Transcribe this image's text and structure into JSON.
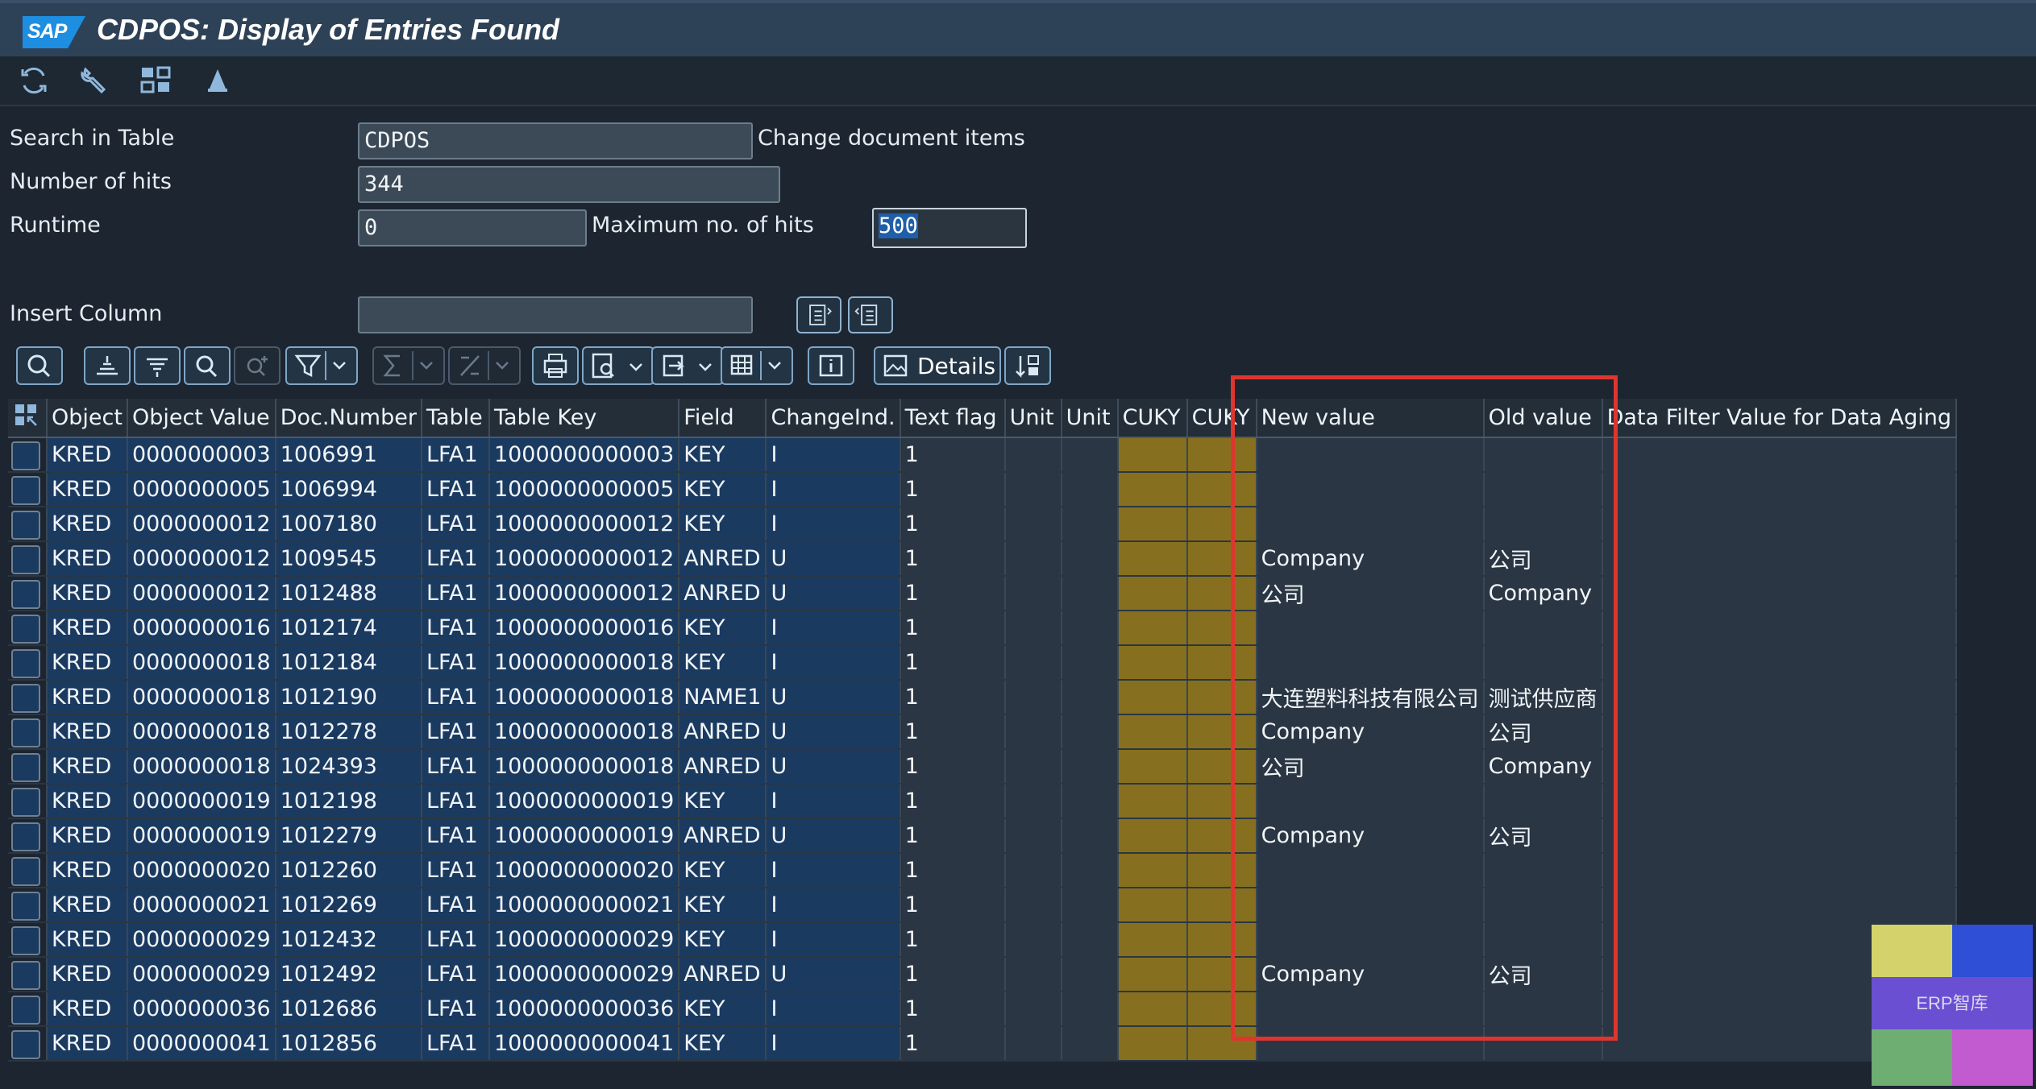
{
  "app": {
    "logo_text": "SAP",
    "title": "CDPOS: Display of Entries Found"
  },
  "toolbar": {
    "icons": [
      "refresh-icon",
      "wrench-icon",
      "structure-icon",
      "drop-icon"
    ]
  },
  "form": {
    "search_in_table_label": "Search in Table",
    "search_in_table_value": "CDPOS",
    "table_description": "Change document items",
    "number_of_hits_label": "Number of hits",
    "number_of_hits_value": "344",
    "runtime_label": "Runtime",
    "runtime_value": "0",
    "max_hits_label": "Maximum no. of hits",
    "max_hits_value": "500",
    "insert_column_label": "Insert Column",
    "insert_column_value": ""
  },
  "alv_toolbar": {
    "details_label": "Details"
  },
  "grid": {
    "columns": [
      "Object",
      "Object Value",
      "Doc.Number",
      "Table",
      "Table Key",
      "Field",
      "ChangeInd.",
      "Text flag",
      "Unit",
      "Unit",
      "CUKY",
      "CUKY",
      "New value",
      "Old value",
      "Data Filter Value for Data Aging"
    ],
    "rows": [
      [
        "KRED",
        "0000000003",
        "1006991",
        "LFA1",
        "1000000000003",
        "KEY",
        "I",
        "1",
        "",
        "",
        "",
        "",
        "",
        "",
        ""
      ],
      [
        "KRED",
        "0000000005",
        "1006994",
        "LFA1",
        "1000000000005",
        "KEY",
        "I",
        "1",
        "",
        "",
        "",
        "",
        "",
        "",
        ""
      ],
      [
        "KRED",
        "0000000012",
        "1007180",
        "LFA1",
        "1000000000012",
        "KEY",
        "I",
        "1",
        "",
        "",
        "",
        "",
        "",
        "",
        ""
      ],
      [
        "KRED",
        "0000000012",
        "1009545",
        "LFA1",
        "1000000000012",
        "ANRED",
        "U",
        "1",
        "",
        "",
        "",
        "",
        "Company",
        "公司",
        ""
      ],
      [
        "KRED",
        "0000000012",
        "1012488",
        "LFA1",
        "1000000000012",
        "ANRED",
        "U",
        "1",
        "",
        "",
        "",
        "",
        "公司",
        "Company",
        ""
      ],
      [
        "KRED",
        "0000000016",
        "1012174",
        "LFA1",
        "1000000000016",
        "KEY",
        "I",
        "1",
        "",
        "",
        "",
        "",
        "",
        "",
        ""
      ],
      [
        "KRED",
        "0000000018",
        "1012184",
        "LFA1",
        "1000000000018",
        "KEY",
        "I",
        "1",
        "",
        "",
        "",
        "",
        "",
        "",
        ""
      ],
      [
        "KRED",
        "0000000018",
        "1012190",
        "LFA1",
        "1000000000018",
        "NAME1",
        "U",
        "1",
        "",
        "",
        "",
        "",
        "大连塑料科技有限公司",
        "测试供应商",
        ""
      ],
      [
        "KRED",
        "0000000018",
        "1012278",
        "LFA1",
        "1000000000018",
        "ANRED",
        "U",
        "1",
        "",
        "",
        "",
        "",
        "Company",
        "公司",
        ""
      ],
      [
        "KRED",
        "0000000018",
        "1024393",
        "LFA1",
        "1000000000018",
        "ANRED",
        "U",
        "1",
        "",
        "",
        "",
        "",
        "公司",
        "Company",
        ""
      ],
      [
        "KRED",
        "0000000019",
        "1012198",
        "LFA1",
        "1000000000019",
        "KEY",
        "I",
        "1",
        "",
        "",
        "",
        "",
        "",
        "",
        ""
      ],
      [
        "KRED",
        "0000000019",
        "1012279",
        "LFA1",
        "1000000000019",
        "ANRED",
        "U",
        "1",
        "",
        "",
        "",
        "",
        "Company",
        "公司",
        ""
      ],
      [
        "KRED",
        "0000000020",
        "1012260",
        "LFA1",
        "1000000000020",
        "KEY",
        "I",
        "1",
        "",
        "",
        "",
        "",
        "",
        "",
        ""
      ],
      [
        "KRED",
        "0000000021",
        "1012269",
        "LFA1",
        "1000000000021",
        "KEY",
        "I",
        "1",
        "",
        "",
        "",
        "",
        "",
        "",
        ""
      ],
      [
        "KRED",
        "0000000029",
        "1012432",
        "LFA1",
        "1000000000029",
        "KEY",
        "I",
        "1",
        "",
        "",
        "",
        "",
        "",
        "",
        ""
      ],
      [
        "KRED",
        "0000000029",
        "1012492",
        "LFA1",
        "1000000000029",
        "ANRED",
        "U",
        "1",
        "",
        "",
        "",
        "",
        "Company",
        "公司",
        ""
      ],
      [
        "KRED",
        "0000000036",
        "1012686",
        "LFA1",
        "1000000000036",
        "KEY",
        "I",
        "1",
        "",
        "",
        "",
        "",
        "",
        "",
        ""
      ],
      [
        "KRED",
        "0000000041",
        "1012856",
        "LFA1",
        "1000000000041",
        "KEY",
        "I",
        "1",
        "",
        "",
        "",
        "",
        "",
        "",
        ""
      ]
    ]
  },
  "watermark": {
    "text": "ERP智库"
  },
  "colors": {
    "key_cell": "#1b3a60",
    "cuky_cell": "#86701f",
    "highlight_box": "#e0352e"
  }
}
